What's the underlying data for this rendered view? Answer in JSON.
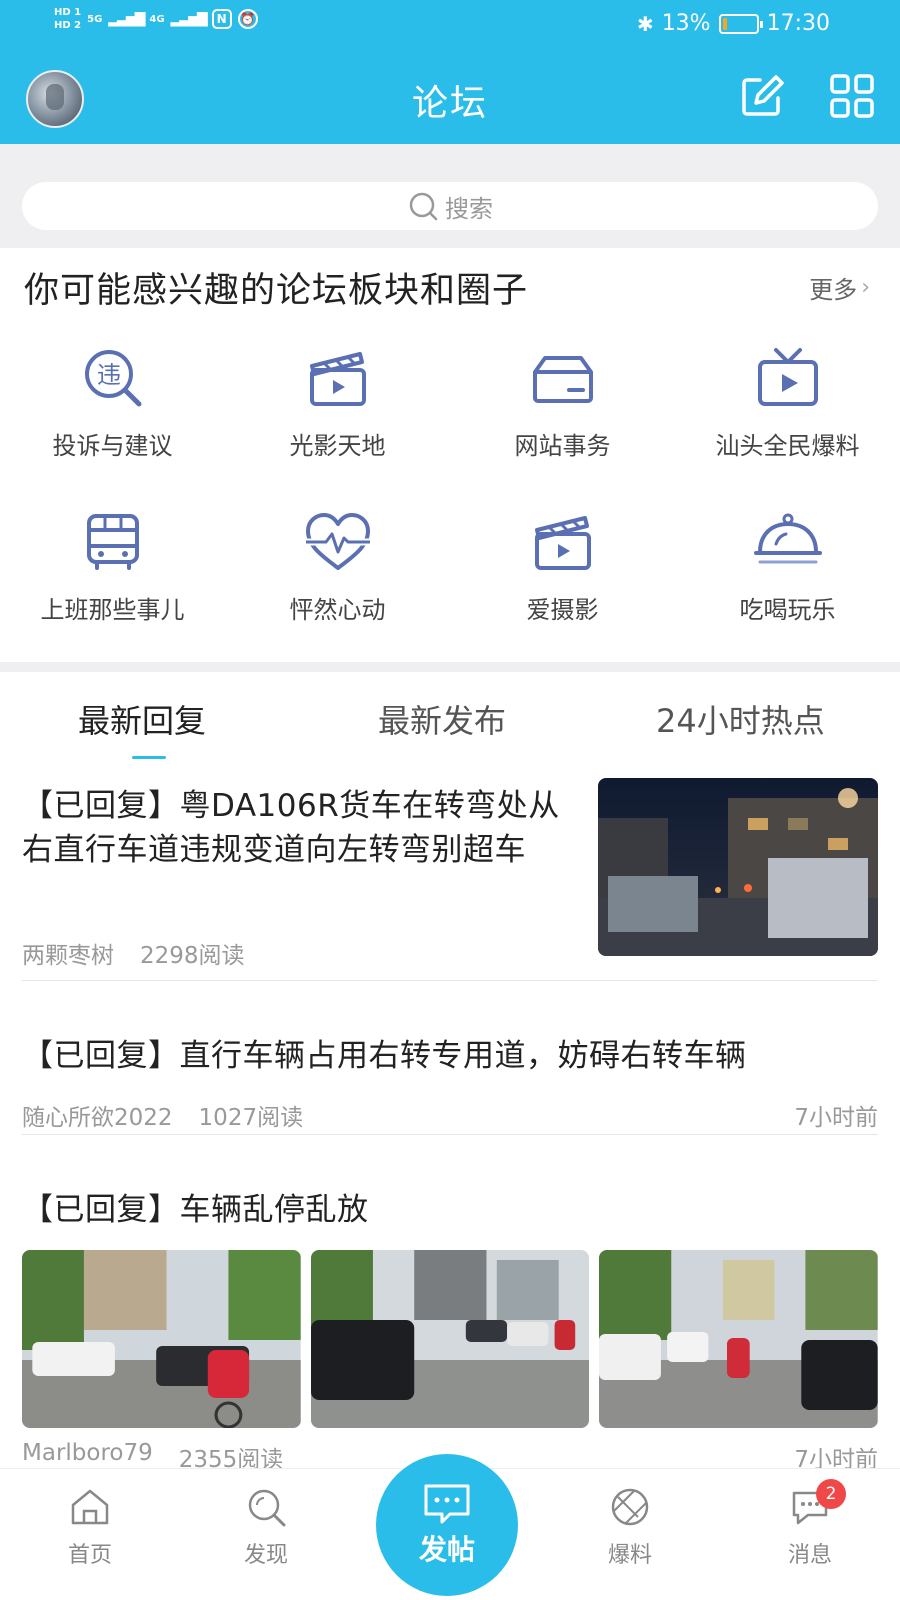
{
  "status_bar": {
    "hd1": "HD 1",
    "hd2": "HD 2",
    "net1": "5G",
    "net2": "4G",
    "nfc": "N",
    "battery_percent": "13%",
    "battery_level": 0.13,
    "time": "17:30"
  },
  "header": {
    "title": "论坛"
  },
  "search": {
    "placeholder": "搜索"
  },
  "interest": {
    "title": "你可能感兴趣的论坛板块和圈子",
    "more": "更多",
    "items": [
      {
        "label": "投诉与建议",
        "icon": "violation-search-icon"
      },
      {
        "label": "光影天地",
        "icon": "clapperboard-icon"
      },
      {
        "label": "网站事务",
        "icon": "card-icon"
      },
      {
        "label": "汕头全民爆料",
        "icon": "tv-icon"
      },
      {
        "label": "上班那些事儿",
        "icon": "bus-icon"
      },
      {
        "label": "怦然心动",
        "icon": "heartbeat-icon"
      },
      {
        "label": "爱摄影",
        "icon": "clapperboard-icon"
      },
      {
        "label": "吃喝玩乐",
        "icon": "food-cloche-icon"
      }
    ],
    "icon_glyph_1": "违"
  },
  "tabs": [
    "最新回复",
    "最新发布",
    "24小时热点"
  ],
  "posts": [
    {
      "title": "【已回复】粤DA106R货车在转弯处从右直行车道违规变道向左转弯别超车",
      "author": "两颗枣树",
      "reads": "2298阅读"
    },
    {
      "title": "【已回复】直行车辆占用右转专用道，妨碍右转车辆",
      "author": "随心所欲2022",
      "reads": "1027阅读",
      "time": "7小时前"
    },
    {
      "title": "【已回复】车辆乱停乱放",
      "author": "Marlboro79",
      "reads": "2355阅读",
      "time": "7小时前"
    }
  ],
  "bottom_nav": {
    "home": "首页",
    "discover": "发现",
    "post": "发帖",
    "scoop": "爆料",
    "messages": "消息",
    "message_badge": "2"
  },
  "colors": {
    "brand": "#2bbde9",
    "icon": "#5b6fb3",
    "badge": "#f04848"
  }
}
